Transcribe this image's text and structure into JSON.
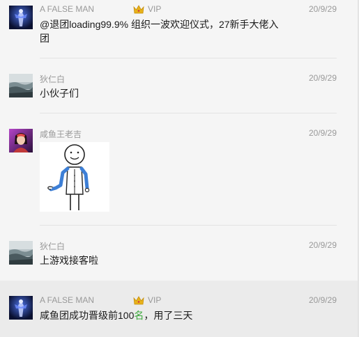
{
  "messages": [
    {
      "user": "A FALSE MAN",
      "badge": "VIP",
      "date": "20/9/29",
      "text_line1": "@退团loading99.9% 组织一波欢迎仪式，27新手大佬入",
      "text_line2": "团",
      "avatar_icon": "blue-figure-avatar-icon"
    },
    {
      "user": "狄仁白",
      "date": "20/9/29",
      "text": "小伙子们",
      "avatar_icon": "landscape-avatar-icon"
    },
    {
      "user": "咸鱼王老吉",
      "date": "20/9/29",
      "image": "waiter-stick-figure-sticker",
      "avatar_icon": "purple-character-avatar-icon"
    },
    {
      "user": "狄仁白",
      "date": "20/9/29",
      "text": "上游戏接客啦",
      "avatar_icon": "landscape-avatar-icon"
    },
    {
      "user": "A FALSE MAN",
      "badge": "VIP",
      "date": "20/9/29",
      "text_before": "咸鱼团成功晋级前100",
      "text_highlight": "名",
      "text_after": "，用了三天",
      "avatar_icon": "blue-figure-avatar-icon"
    }
  ],
  "colors": {
    "background": "#f5f5f5",
    "highlight_row": "#ebebeb",
    "meta_text": "#999999",
    "body_text": "#1a1a1a",
    "accent_green": "#3aa83a",
    "vip_crown": "#e8b21a"
  }
}
